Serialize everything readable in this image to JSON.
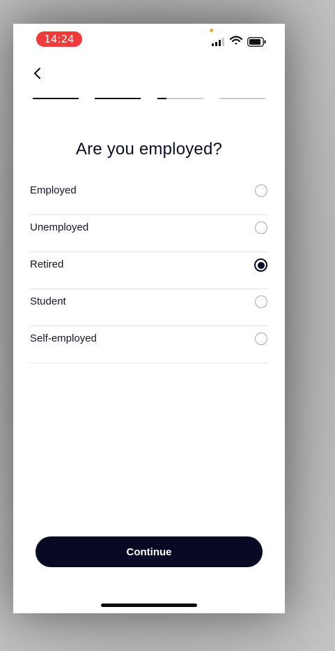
{
  "status_bar": {
    "time": "14:24",
    "time_pill_color": "#ef3b3b",
    "icons": [
      "signal-icon",
      "wifi-icon",
      "battery-icon"
    ]
  },
  "navigation": {
    "back_icon": "chevron-left-icon"
  },
  "progress": {
    "total_steps": 4,
    "step_fill": [
      1,
      1,
      0.2,
      0
    ]
  },
  "question": {
    "title": "Are you employed?"
  },
  "options": [
    {
      "label": "Employed",
      "selected": false
    },
    {
      "label": "Unemployed",
      "selected": false
    },
    {
      "label": "Retired",
      "selected": true
    },
    {
      "label": "Student",
      "selected": false
    },
    {
      "label": "Self-employed",
      "selected": false
    }
  ],
  "footer": {
    "continue_label": "Continue"
  },
  "colors": {
    "primary": "#070a22",
    "progress_track": "#c9cad4",
    "divider": "#e4e4ea"
  }
}
